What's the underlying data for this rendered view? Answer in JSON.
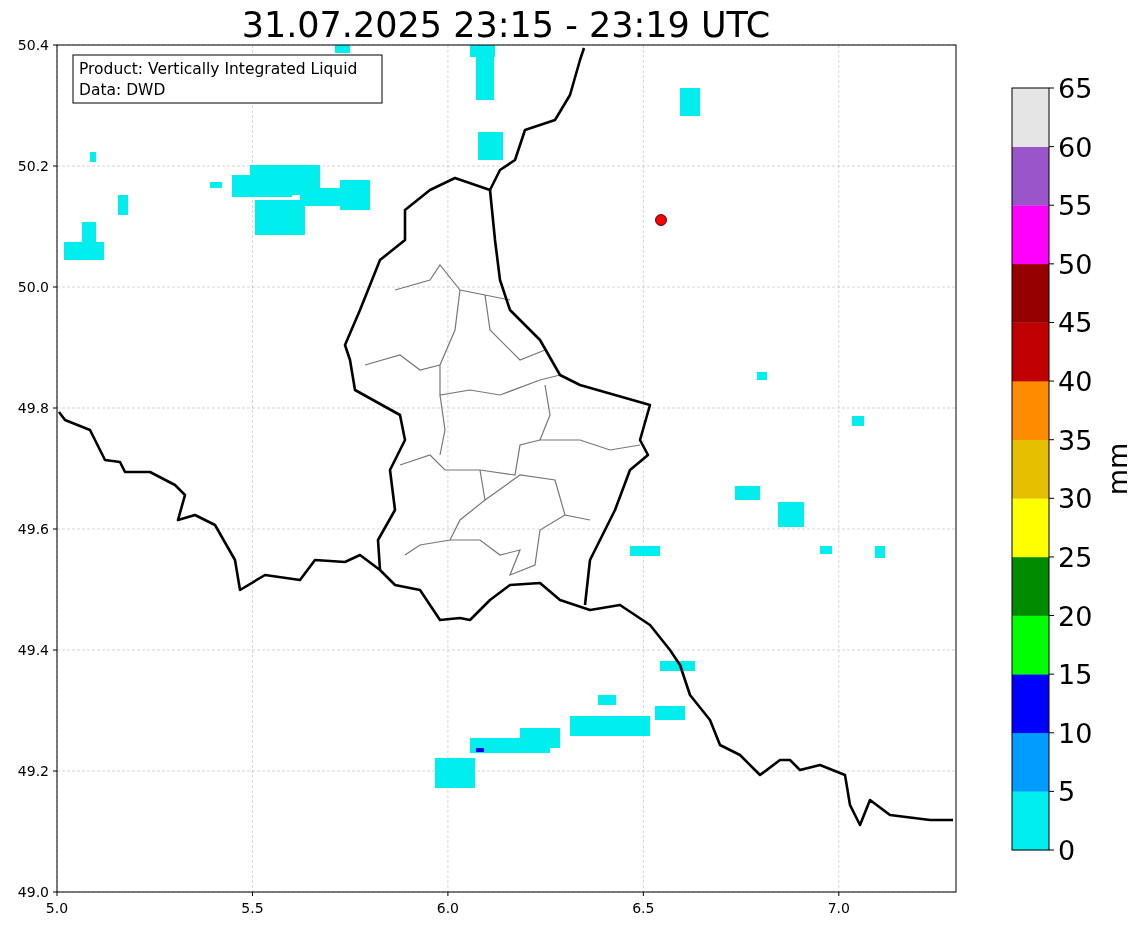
{
  "title": "31.07.2025 23:15 - 23:19 UTC",
  "legend": [
    "Product: Vertically Integrated Liquid",
    "Data: DWD"
  ],
  "x_ticks": [
    "5.0",
    "5.5",
    "6.0",
    "6.5",
    "7.0"
  ],
  "y_ticks": [
    "50.4",
    "50.2",
    "50.0",
    "49.8",
    "49.6",
    "49.4",
    "49.2",
    "49.0"
  ],
  "colorbar": {
    "label": "mm",
    "ticks": [
      "65",
      "60",
      "55",
      "50",
      "45",
      "40",
      "35",
      "30",
      "25",
      "20",
      "15",
      "10",
      "5",
      "0"
    ],
    "bands": [
      {
        "color": "#00eeee"
      },
      {
        "color": "#009cff"
      },
      {
        "color": "#0000ff"
      },
      {
        "color": "#00ff00"
      },
      {
        "color": "#008c00"
      },
      {
        "color": "#ffff00"
      },
      {
        "color": "#e6c000"
      },
      {
        "color": "#ff8c00"
      },
      {
        "color": "#c00000"
      },
      {
        "color": "#960000"
      },
      {
        "color": "#ff00ff"
      },
      {
        "color": "#9955c9"
      },
      {
        "color": "#e5e5e5"
      }
    ]
  }
}
